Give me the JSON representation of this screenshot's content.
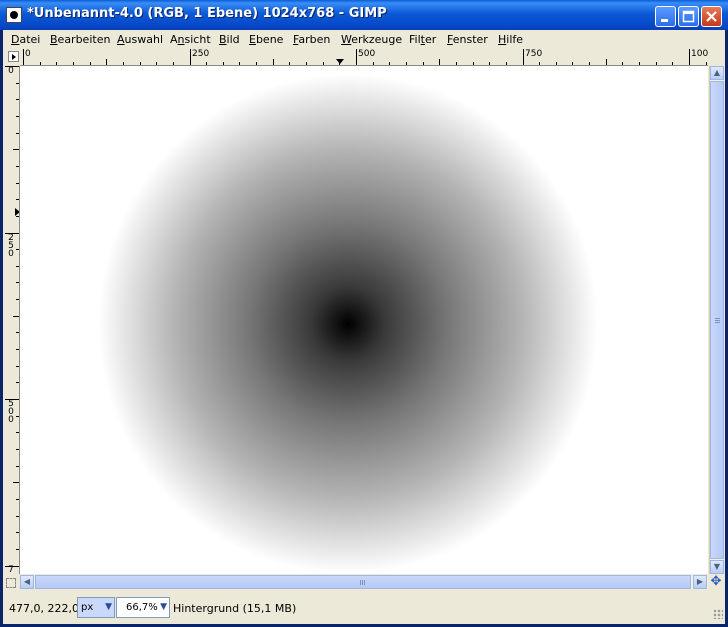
{
  "window": {
    "title": "*Unbenannt-4.0 (RGB, 1 Ebene) 1024x768 - GIMP"
  },
  "menu": [
    {
      "label": "Datei",
      "accel": "D",
      "rest": "atei"
    },
    {
      "label": "Bearbeiten",
      "accel": "B",
      "rest": "earbeiten"
    },
    {
      "label": "Auswahl",
      "accel": "A",
      "rest": "uswahl"
    },
    {
      "label": "Ansicht",
      "accel": "n",
      "pre": "A",
      "rest": "sicht"
    },
    {
      "label": "Bild",
      "accel": "B",
      "rest": "ild"
    },
    {
      "label": "Ebene",
      "accel": "E",
      "rest": "bene"
    },
    {
      "label": "Farben",
      "accel": "F",
      "rest": "arben"
    },
    {
      "label": "Werkzeuge",
      "accel": "W",
      "rest": "erkzeuge"
    },
    {
      "label": "Filter",
      "accel": "t",
      "pre": "Fil",
      "rest": "er"
    },
    {
      "label": "Fenster",
      "accel": "F",
      "rest": "enster"
    },
    {
      "label": "Hilfe",
      "accel": "H",
      "rest": "ilfe"
    }
  ],
  "ruler": {
    "h_labels": [
      "0",
      "250",
      "500",
      "750",
      "100"
    ],
    "v_labels": [
      "0",
      "2\n5\n0",
      "5\n0\n0",
      "7"
    ]
  },
  "status": {
    "coords": "477,0, 222,0",
    "unit": "px",
    "zoom": "66,7%",
    "message": "Hintergrund (15,1 MB)"
  },
  "icons": {
    "app": "gimp-image-icon",
    "minimize": "minimize-icon",
    "maximize": "maximize-icon",
    "close": "close-icon",
    "navigate": "navigate-icon"
  }
}
